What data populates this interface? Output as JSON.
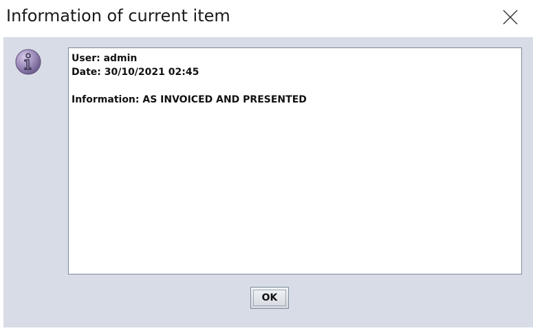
{
  "dialog": {
    "title": "Information of current item",
    "close_icon": "close-icon",
    "info_icon": "info-icon",
    "message": {
      "user_line": "User: admin",
      "date_line": "Date: 30/10/2021 02:45",
      "information_line": "Information: AS INVOICED AND PRESENTED"
    },
    "ok_label": "OK"
  },
  "colors": {
    "content_background": "#d8dce6",
    "icon_purple": "#9b8ab8"
  }
}
